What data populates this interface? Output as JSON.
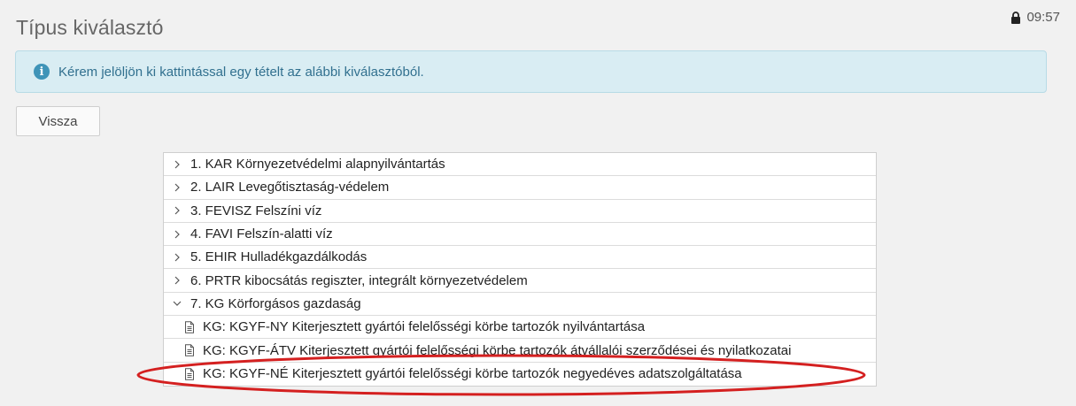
{
  "header": {
    "title": "Típus kiválasztó",
    "time": "09:57"
  },
  "alert": {
    "message": "Kérem jelöljön ki kattintással egy tételt az alábbi kiválasztóból."
  },
  "actions": {
    "back_label": "Vissza"
  },
  "tree": {
    "categories": [
      {
        "label": "1. KAR Környezetvédelmi alapnyilvántartás",
        "expanded": false
      },
      {
        "label": "2. LAIR Levegőtisztaság-védelem",
        "expanded": false
      },
      {
        "label": "3. FEVISZ Felszíni víz",
        "expanded": false
      },
      {
        "label": "4. FAVI Felszín-alatti víz",
        "expanded": false
      },
      {
        "label": "5. EHIR Hulladékgazdálkodás",
        "expanded": false
      },
      {
        "label": "6. PRTR kibocsátás regiszter, integrált környezetvédelem",
        "expanded": false
      },
      {
        "label": "7. KG Körforgásos gazdaság",
        "expanded": true
      }
    ],
    "children": [
      {
        "label": "KG: KGYF-NY Kiterjesztett gyártói felelősségi körbe tartozók nyilvántartása"
      },
      {
        "label": "KG: KGYF-ÁTV Kiterjesztett gyártói felelősségi körbe tartozók átvállalói szerződései és nyilatkozatai"
      },
      {
        "label": "KG: KGYF-NÉ Kiterjesztett gyártói felelősségi körbe tartozók negyedéves adatszolgáltatása"
      }
    ]
  },
  "colors": {
    "highlight": "#d42020",
    "alert_bg": "#d9edf3",
    "alert_text": "#31708f",
    "info_icon": "#3f94b8"
  },
  "icons": {
    "session": "lock-icon",
    "alert": "info-icon",
    "collapsed": "chevron-right-icon",
    "expanded": "chevron-down-icon",
    "child": "document-icon"
  }
}
